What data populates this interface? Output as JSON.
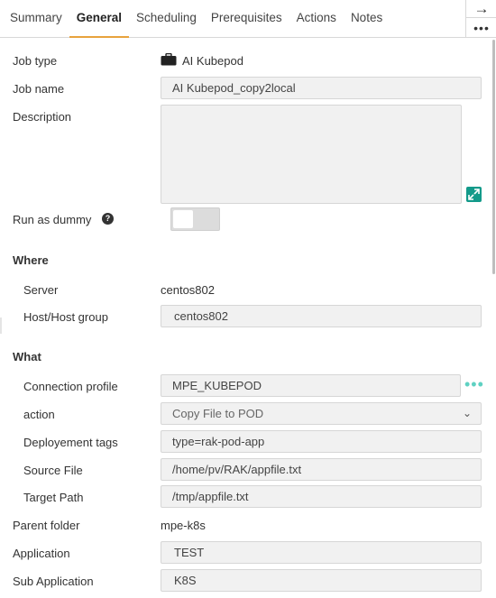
{
  "tabs": [
    "Summary",
    "General",
    "Scheduling",
    "Prerequisites",
    "Actions",
    "Notes"
  ],
  "active_tab": "General",
  "side_tools": {
    "arrow": "→",
    "more": "•••"
  },
  "fields": {
    "job_type": {
      "label": "Job type",
      "value": "AI Kubepod",
      "icon": "briefcase-icon"
    },
    "job_name": {
      "label": "Job name",
      "value": "AI Kubepod_copy2local"
    },
    "description": {
      "label": "Description",
      "value": ""
    },
    "run_as_dummy": {
      "label": "Run as dummy",
      "help": "?",
      "enabled": false
    }
  },
  "where": {
    "heading": "Where",
    "server": {
      "label": "Server",
      "value": "centos802"
    },
    "host": {
      "label": "Host/Host group",
      "value": "centos802"
    }
  },
  "what": {
    "heading": "What",
    "connection_profile": {
      "label": "Connection profile",
      "value": "MPE_KUBEPOD",
      "more": "•••"
    },
    "action": {
      "label": "action",
      "value": "Copy File to POD"
    },
    "deployement_tags": {
      "label": "Deployement tags",
      "value": "type=rak-pod-app"
    },
    "source_file": {
      "label": "Source File",
      "value": "/home/pv/RAK/appfile.txt"
    },
    "target_path": {
      "label": "Target Path",
      "value": "/tmp/appfile.txt"
    }
  },
  "parent_folder": {
    "label": "Parent folder",
    "value": "mpe-k8s"
  },
  "application": {
    "label": "Application",
    "value": "TEST"
  },
  "sub_application": {
    "label": "Sub Application",
    "value": "K8S"
  },
  "colors": {
    "accent": "#e8a33d",
    "teal": "#139a8a",
    "field_bg": "#f1f1f1"
  }
}
